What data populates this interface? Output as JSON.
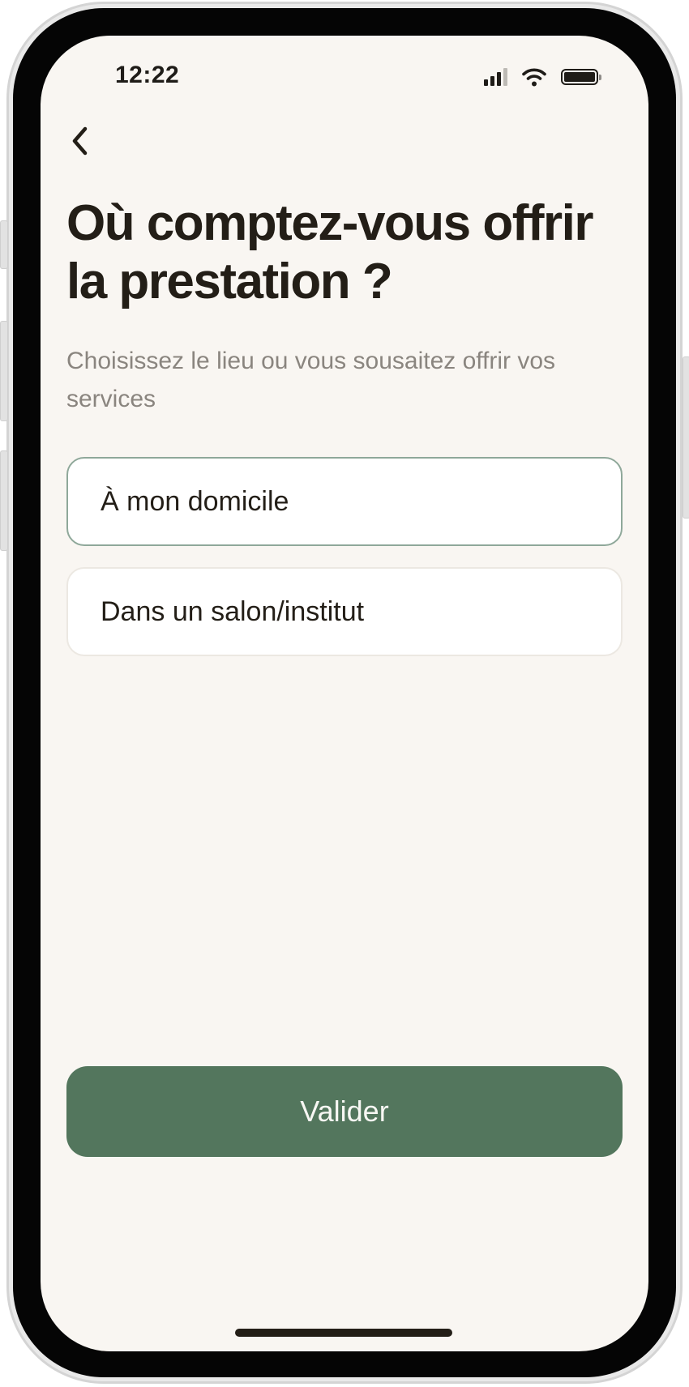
{
  "status_bar": {
    "time": "12:22"
  },
  "navigation": {
    "back_icon": "chevron-left-icon"
  },
  "header": {
    "title": "Où comptez-vous offrir la prestation ?",
    "subtitle": "Choisissez le lieu ou vous sousaitez offrir vos services"
  },
  "options": [
    {
      "label": "À mon domicile",
      "selected": true
    },
    {
      "label": "Dans un salon/institut",
      "selected": false
    }
  ],
  "actions": {
    "validate_label": "Valider"
  },
  "colors": {
    "background": "#f9f6f2",
    "primary": "#53765d",
    "selected_border": "#8fa89a",
    "text": "#231e17",
    "muted_text": "#8a857f"
  }
}
